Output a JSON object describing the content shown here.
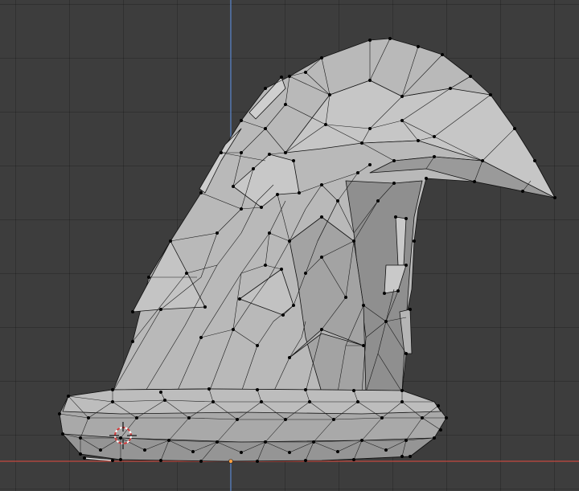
{
  "viewport": {
    "object": "wizard-hat-mesh",
    "mode": "edit-mode",
    "axis_colors": {
      "x_axis": "#c4493f",
      "z_axis": "#5b84c7"
    },
    "mesh_colors": {
      "face_light": "#bdbdbd",
      "face_mid": "#a8a8a8",
      "face_dark": "#8e8e8e",
      "edge": "#111111",
      "vertex": "#000000"
    },
    "cursor_icon": "3d-cursor-icon",
    "origin_icon": "object-origin-icon"
  }
}
